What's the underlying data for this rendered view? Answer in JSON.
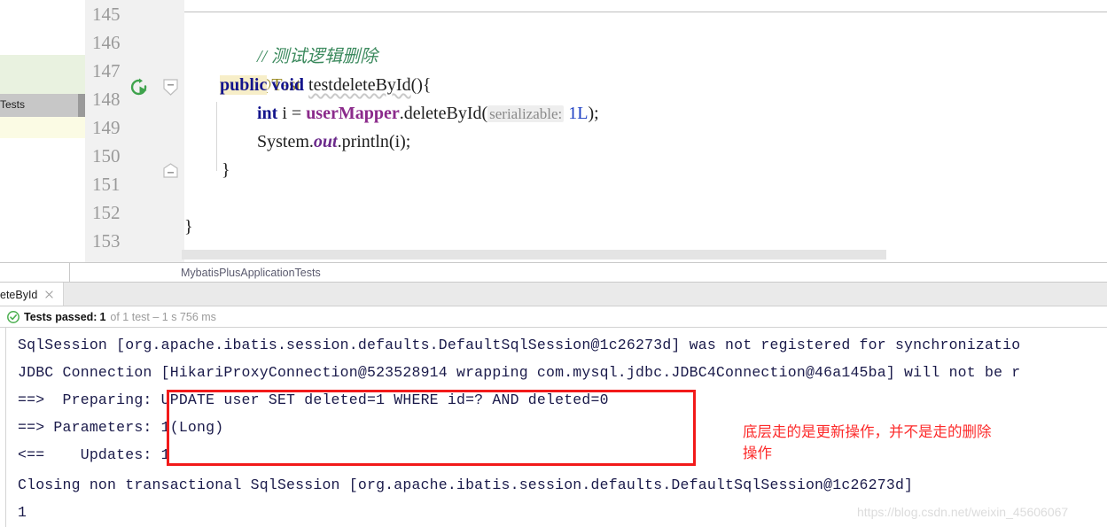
{
  "editor": {
    "line_numbers": [
      "145",
      "146",
      "147",
      "148",
      "149",
      "150",
      "151",
      "152",
      "153"
    ],
    "run_gutter_icon": "run-test-green-icon",
    "fold_icons": [
      "fold-minus-icon",
      "fold-minus-icon"
    ],
    "code": {
      "comment": "// 测试逻辑删除",
      "annotation": "@Test",
      "sig_kw1": "public",
      "sig_kw2": "void",
      "sig_name": "testdeleteById",
      "sig_tail": "(){",
      "body_kw": "int",
      "body_var": " i = ",
      "body_field": "userMapper",
      "body_call": ".deleteById(",
      "body_hint": "serializable:",
      "body_arg": " 1L",
      "body_end": ");",
      "print_obj": "System.",
      "print_static": "out",
      "print_call": ".println(i);",
      "close_inner": "}",
      "close_outer": "}"
    }
  },
  "breadcrumb": {
    "text": "MybatisPlusApplicationTests"
  },
  "left_panel": {
    "selected_label": "Tests"
  },
  "run_tab": {
    "label": "eteById",
    "close_icon": "close-icon"
  },
  "status": {
    "icon": "test-passed-check-icon",
    "label": "Tests passed:",
    "count": "1",
    "detail": "of 1 test – 1 s 756 ms"
  },
  "console": {
    "lines": [
      "SqlSession [org.apache.ibatis.session.defaults.DefaultSqlSession@1c26273d] was not registered for synchronizatio",
      "JDBC Connection [HikariProxyConnection@523528914 wrapping com.mysql.jdbc.JDBC4Connection@46a145ba] will not be r",
      "==>  Preparing: UPDATE user SET deleted=1 WHERE id=? AND deleted=0",
      "==> Parameters: 1(Long)",
      "<==    Updates: 1",
      "Closing non transactional SqlSession [org.apache.ibatis.session.defaults.DefaultSqlSession@1c26273d]",
      "1"
    ]
  },
  "annotation": {
    "red_note": "底层走的是更新操作，并不是走的删除\n操作",
    "box_color": "#f21a1a",
    "text_color": "#fc2b2b"
  },
  "watermark": {
    "text": "https://blog.csdn.net/weixin_45606067"
  }
}
